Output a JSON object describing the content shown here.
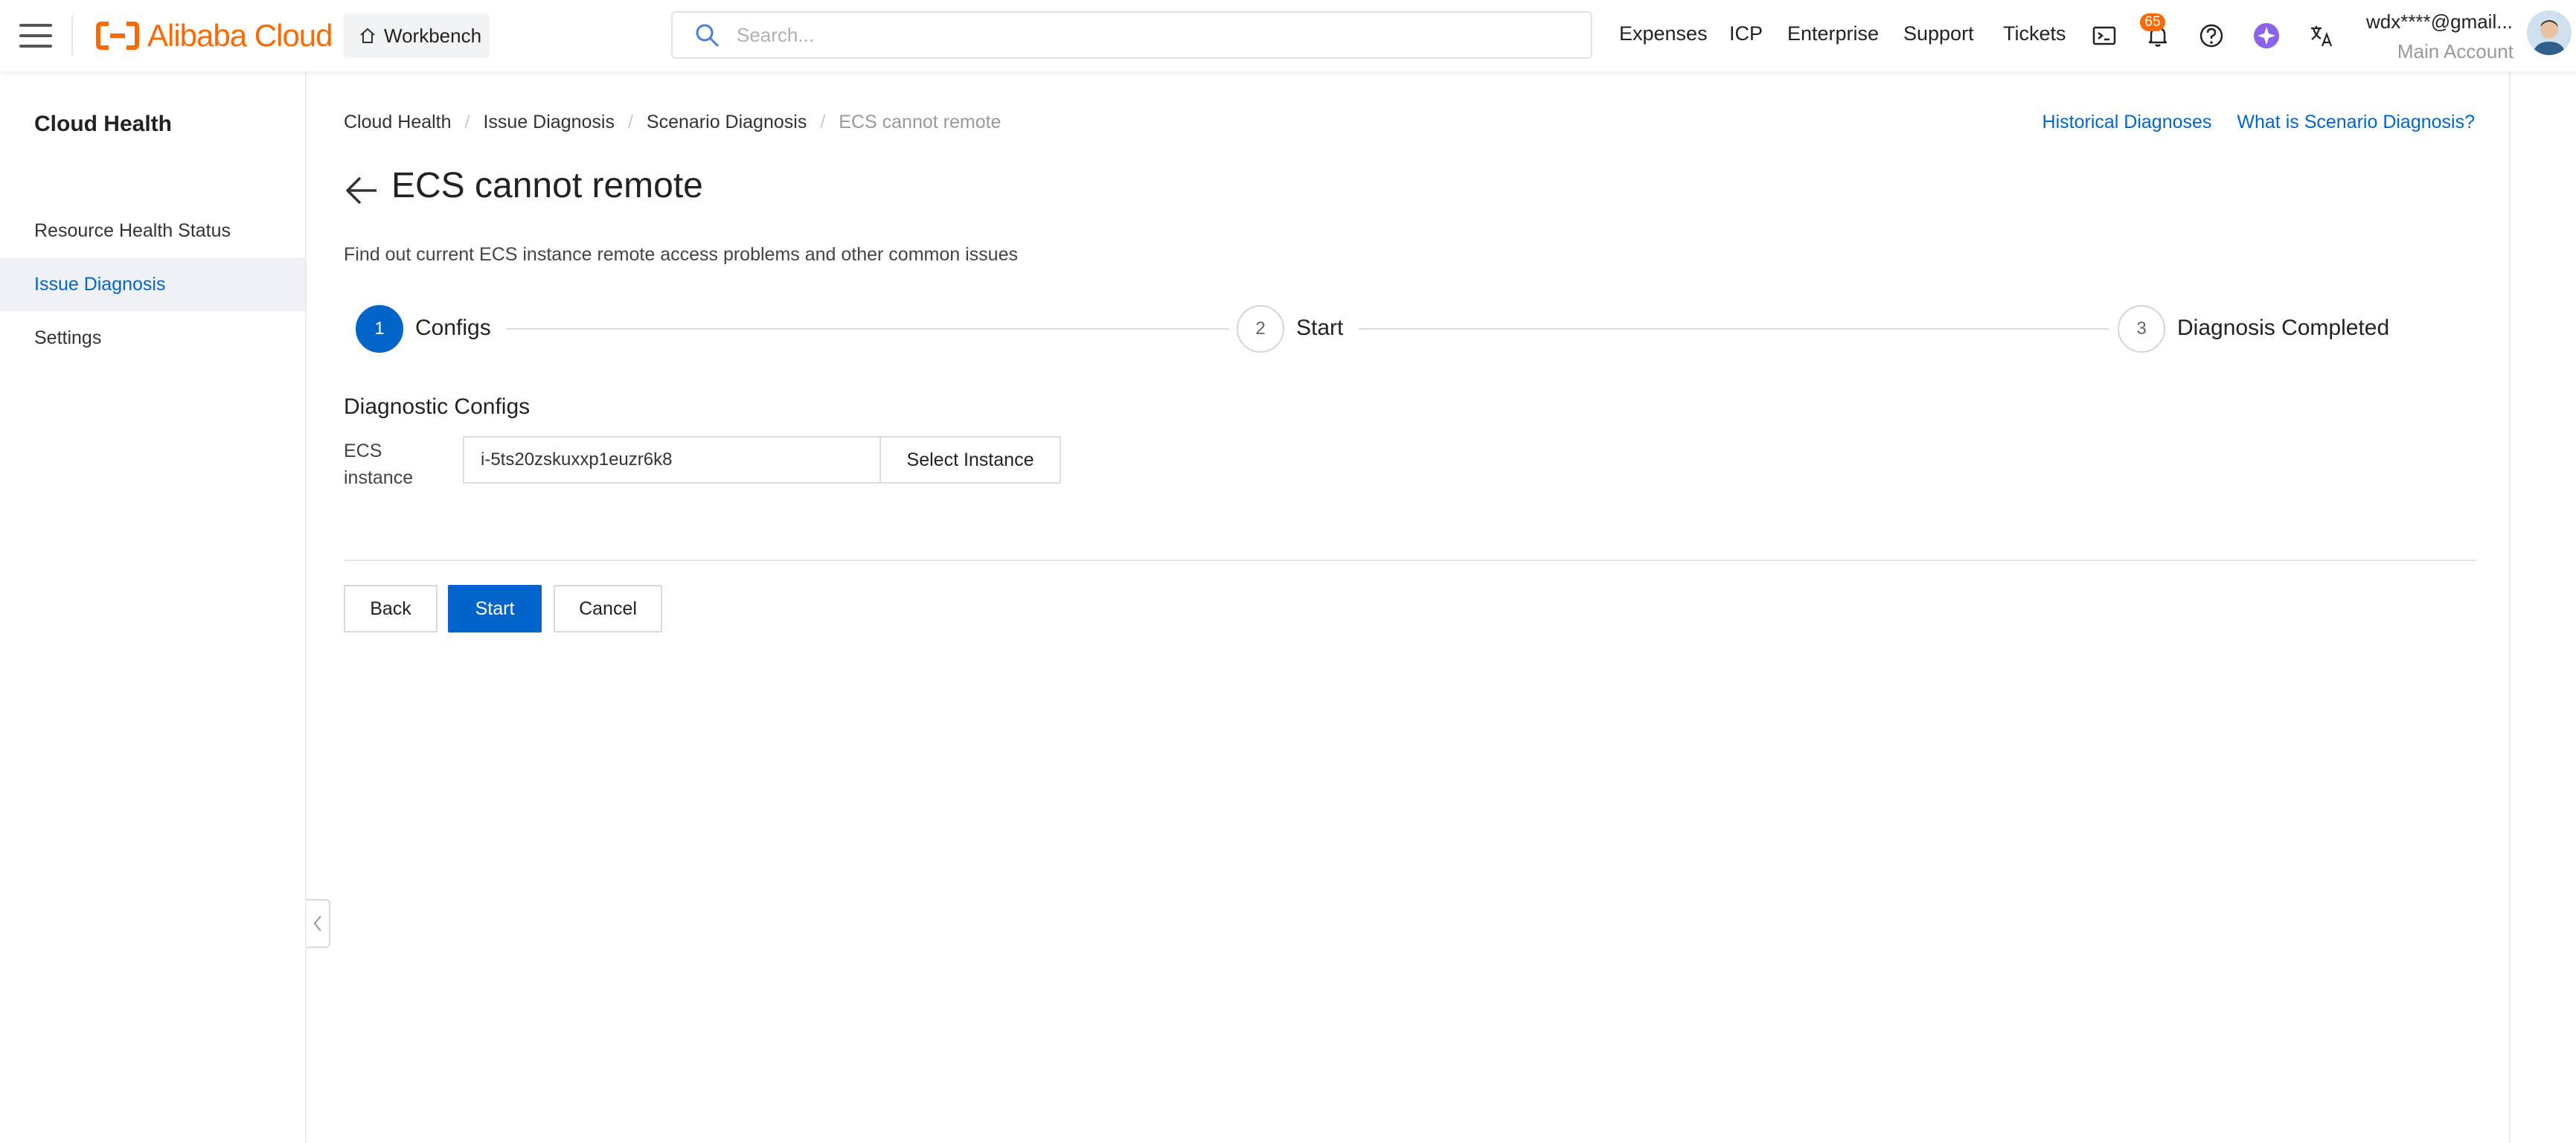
{
  "header": {
    "brand": "Alibaba Cloud",
    "workbench_label": "Workbench",
    "search_placeholder": "Search...",
    "nav": [
      "Expenses",
      "ICP",
      "Enterprise",
      "Support",
      "Tickets"
    ],
    "notification_count": "65",
    "user_email": "wdx****@gmail...",
    "user_role": "Main Account",
    "brand_color": "#ff6a00"
  },
  "sidebar": {
    "title": "Cloud Health",
    "items": [
      {
        "label": "Resource Health Status",
        "active": false
      },
      {
        "label": "Issue Diagnosis",
        "active": true
      },
      {
        "label": "Settings",
        "active": false
      }
    ]
  },
  "breadcrumb": [
    "Cloud Health",
    "Issue Diagnosis",
    "Scenario Diagnosis",
    "ECS cannot remote"
  ],
  "top_links": [
    "Historical Diagnoses",
    "What is Scenario Diagnosis?"
  ],
  "page": {
    "title": "ECS cannot remote",
    "description": "Find out current ECS instance remote access problems and other common issues"
  },
  "steps": [
    {
      "number": "1",
      "label": "Configs",
      "active": true
    },
    {
      "number": "2",
      "label": "Start",
      "active": false
    },
    {
      "number": "3",
      "label": "Diagnosis Completed",
      "active": false
    }
  ],
  "form": {
    "section_title": "Diagnostic Configs",
    "field_label": "ECS instance",
    "field_value": "i-5ts20zskuxxp1euzr6k8",
    "select_button": "Select Instance"
  },
  "actions": {
    "back": "Back",
    "start": "Start",
    "cancel": "Cancel"
  },
  "colors": {
    "primary": "#0064c8",
    "accent": "#ff6a00"
  }
}
